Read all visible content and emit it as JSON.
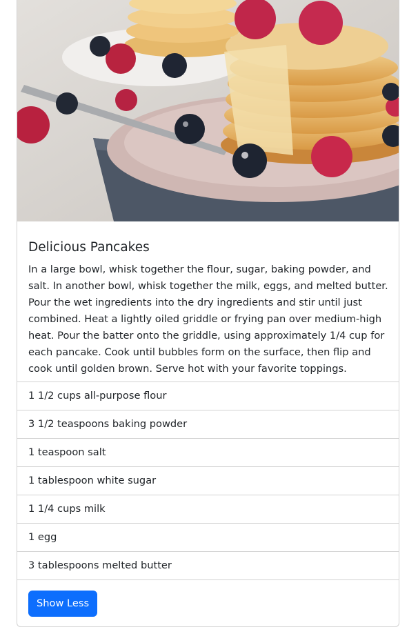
{
  "recipe": {
    "title": "Delicious Pancakes",
    "description": "In a large bowl, whisk together the flour, sugar, baking powder, and salt. In another bowl, whisk together the milk, eggs, and melted butter. Pour the wet ingredients into the dry ingredients and stir until just combined. Heat a lightly oiled griddle or frying pan over medium-high heat. Pour the batter onto the griddle, using approximately 1/4 cup for each pancake. Cook until bubbles form on the surface, then flip and cook until golden brown. Serve hot with your favorite toppings.",
    "ingredients": [
      "1 1/2 cups all-purpose flour",
      "3 1/2 teaspoons baking powder",
      "1 teaspoon salt",
      "1 tablespoon white sugar",
      "1 1/4 cups milk",
      "1 egg",
      "3 tablespoons melted butter"
    ],
    "toggle_label": "Show Less"
  },
  "colors": {
    "primary": "#0d6efd",
    "text": "#212529",
    "border": "#dee2e6"
  }
}
